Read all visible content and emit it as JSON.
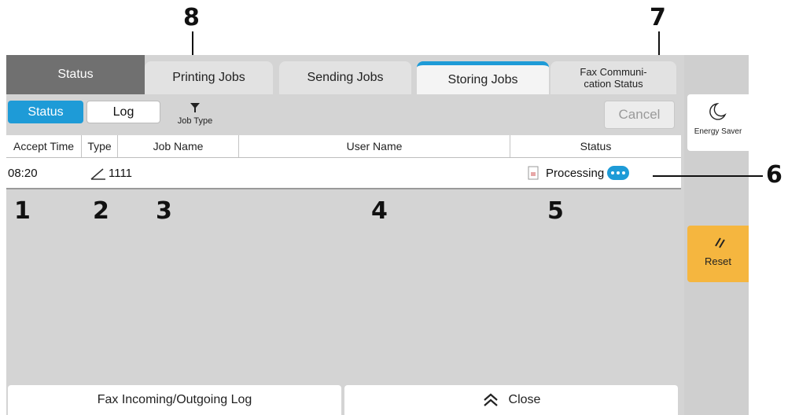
{
  "tabs": {
    "status": "Status",
    "printing": "Printing Jobs",
    "sending": "Sending Jobs",
    "storing": "Storing Jobs",
    "fax_line1": "Fax Communi-",
    "fax_line2": "cation Status"
  },
  "toolbar": {
    "status_btn": "Status",
    "log_btn": "Log",
    "job_type": "Job Type",
    "cancel": "Cancel"
  },
  "columns": {
    "accept_time": "Accept Time",
    "type": "Type",
    "job_name": "Job Name",
    "user_name": "User Name",
    "status": "Status"
  },
  "job": {
    "time": "08:20",
    "type_icon": "scan-to-box-icon",
    "name": "1111",
    "user": "",
    "status_icon": "document-icon",
    "status": "Processing"
  },
  "bottom": {
    "fax_log": "Fax Incoming/Outgoing Log",
    "close": "Close"
  },
  "side": {
    "energy_saver": "Energy Saver",
    "reset": "Reset"
  },
  "callouts": [
    "1",
    "2",
    "3",
    "4",
    "5",
    "6",
    "7",
    "8"
  ],
  "colors": {
    "accent": "#1e9bd7",
    "reset": "#f5b63f",
    "active_tab_bar": "#1e9bd7",
    "status_tab": "#707070"
  }
}
